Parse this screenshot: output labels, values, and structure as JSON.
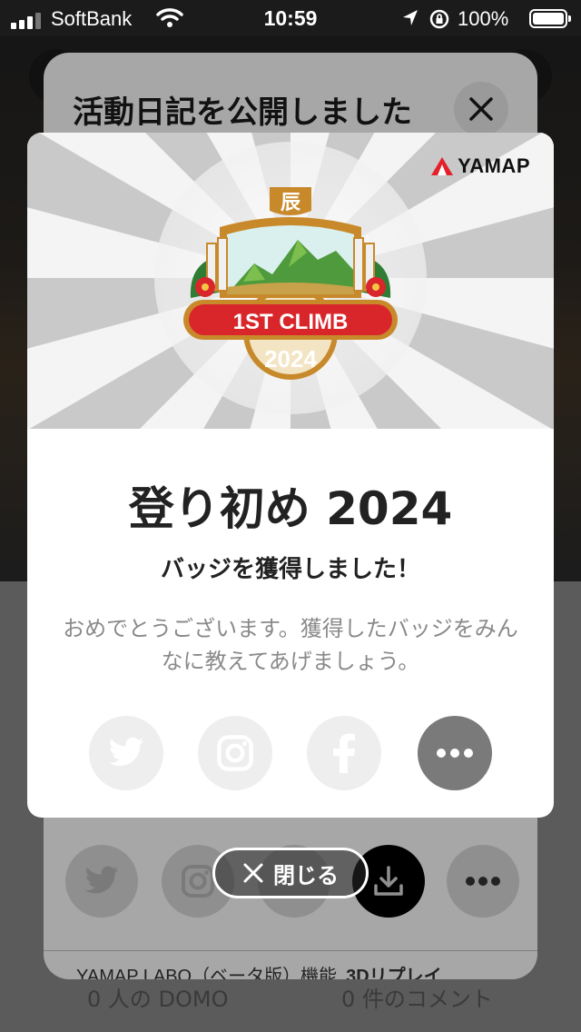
{
  "status_bar": {
    "carrier": "SoftBank",
    "time": "10:59",
    "battery": "100%"
  },
  "sheet": {
    "title": "活動日記を公開しました",
    "labo_label": "YAMAP LABO（ベータ版）機能",
    "replay_label": "3Dリプレイ",
    "share_icons": [
      "twitter-icon",
      "instagram-icon",
      "facebook-icon",
      "download-icon",
      "more-icon"
    ]
  },
  "background": {
    "domo_count": "0 人の DOMO",
    "comment_count": "0 件のコメント"
  },
  "modal": {
    "logo": "YAMAP",
    "badge": {
      "kanji": "辰",
      "ribbon": "1ST CLIMB",
      "year": "2024"
    },
    "title": "登り初め 2024",
    "subtitle": "バッジを獲得しました！",
    "description": "おめでとうございます。獲得したバッジをみんなに教えてあげましょう。",
    "share": [
      {
        "name": "twitter-share-button",
        "icon": "twitter-icon"
      },
      {
        "name": "instagram-share-button",
        "icon": "instagram-icon"
      },
      {
        "name": "facebook-share-button",
        "icon": "facebook-icon"
      },
      {
        "name": "more-share-button",
        "icon": "more-icon"
      }
    ]
  },
  "close_button": {
    "label": "閉じる"
  },
  "colors": {
    "badge_red": "#d8262b",
    "badge_gold": "#c8892b",
    "badge_green": "#3f8f3a",
    "logo_red": "#e4202a",
    "more_button": "#7a7a7a"
  }
}
